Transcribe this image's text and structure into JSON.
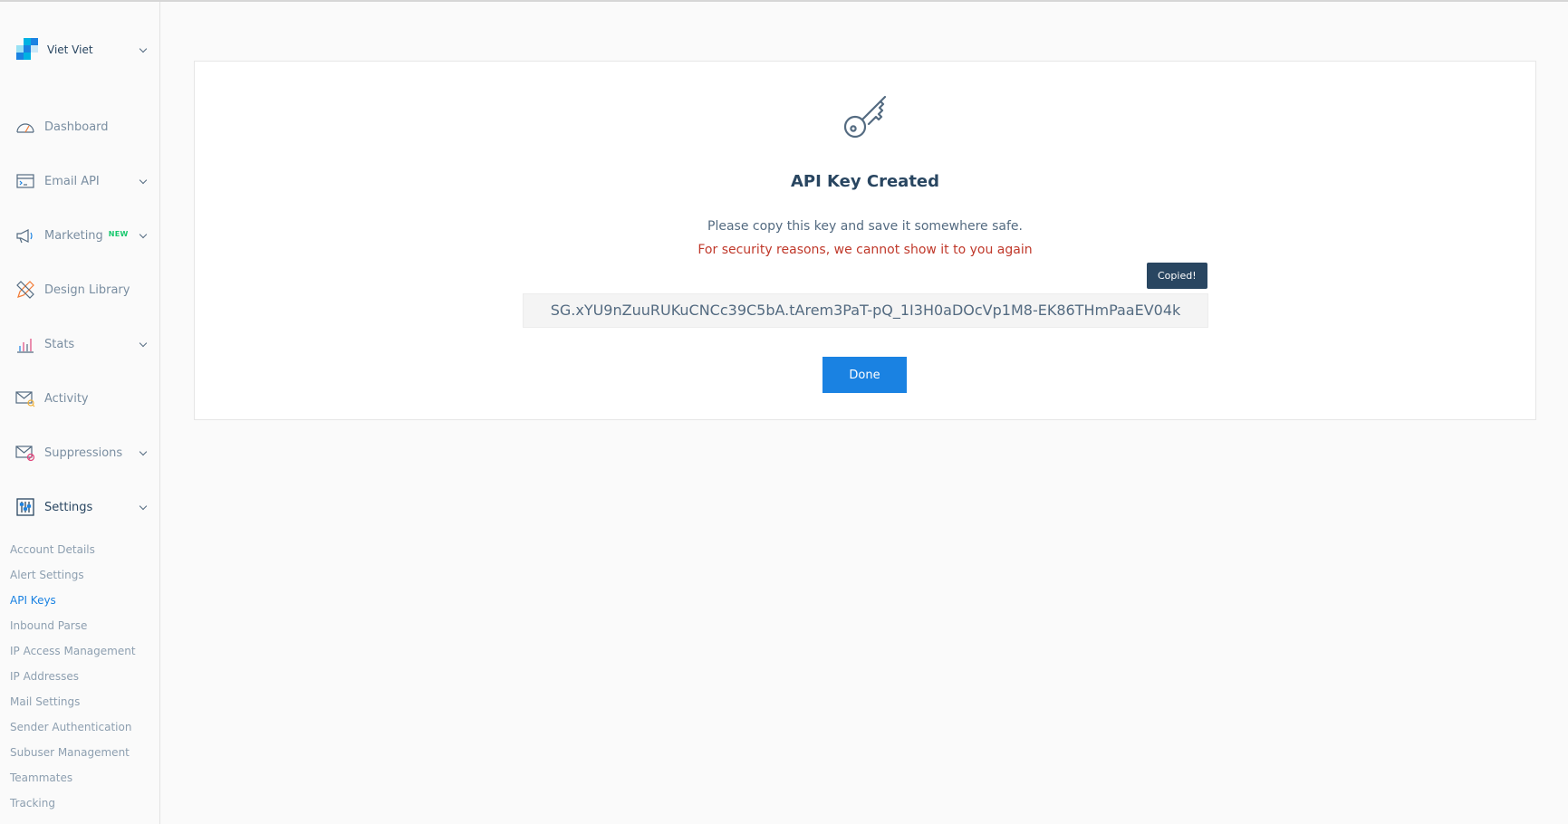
{
  "account": {
    "name": "Viet Viet",
    "logo_colors": [
      "#1a82e2",
      "#00b2e3",
      "#99e1f4",
      "#c9e8f8"
    ]
  },
  "sidebar": {
    "items": [
      {
        "label": "Dashboard",
        "icon": "dashboard-gauge-icon",
        "has_chevron": false
      },
      {
        "label": "Email API",
        "icon": "email-api-terminal-icon",
        "has_chevron": true
      },
      {
        "label": "Marketing",
        "badge": "NEW",
        "icon": "megaphone-icon",
        "has_chevron": true
      },
      {
        "label": "Design Library",
        "icon": "pencil-ruler-icon",
        "has_chevron": false
      },
      {
        "label": "Stats",
        "icon": "bar-chart-icon",
        "has_chevron": true
      },
      {
        "label": "Activity",
        "icon": "envelope-search-icon",
        "has_chevron": false
      },
      {
        "label": "Suppressions",
        "icon": "envelope-block-icon",
        "has_chevron": true
      },
      {
        "label": "Settings",
        "icon": "sliders-icon",
        "has_chevron": true,
        "active": true
      }
    ],
    "settings_sub": [
      {
        "label": "Account Details"
      },
      {
        "label": "Alert Settings"
      },
      {
        "label": "API Keys",
        "active": true
      },
      {
        "label": "Inbound Parse"
      },
      {
        "label": "IP Access Management"
      },
      {
        "label": "IP Addresses"
      },
      {
        "label": "Mail Settings"
      },
      {
        "label": "Sender Authentication"
      },
      {
        "label": "Subuser Management"
      },
      {
        "label": "Teammates"
      },
      {
        "label": "Tracking"
      }
    ]
  },
  "main": {
    "icon": "key-icon",
    "title": "API Key Created",
    "subtitle": "Please copy this key and save it somewhere safe.",
    "warning": "For security reasons, we cannot show it to you again",
    "tooltip": "Copied!",
    "api_key": "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",
    "done_label": "Done"
  },
  "colors": {
    "accent": "#1a82e2",
    "warning": "#c0392b",
    "badge_new": "#18c96e",
    "navy": "#294661"
  }
}
